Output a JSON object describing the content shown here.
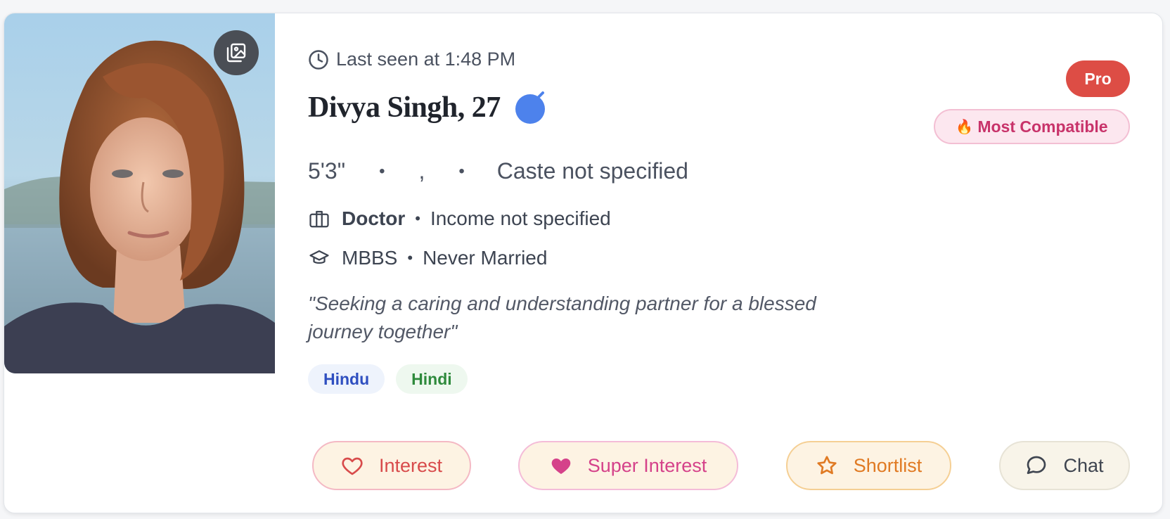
{
  "profile": {
    "last_seen": "Last seen at 1:48 PM",
    "name": "Divya Singh, 27",
    "height": "5'3\"",
    "sep1": "•",
    "location": ",",
    "sep2": "•",
    "caste": "Caste not specified",
    "profession": "Doctor",
    "income": "Income not specified",
    "education": "MBBS",
    "marital_status": "Never Married",
    "bullet": "•",
    "tagline": "\"Seeking a caring and understanding partner for a blessed journey together\"",
    "tags": [
      {
        "label": "Hindu"
      },
      {
        "label": "Hindi"
      }
    ]
  },
  "badges": {
    "pro": "Pro",
    "compat_emoji": "🔥",
    "compat": "Most Compatible"
  },
  "actions": {
    "interest": "Interest",
    "super_interest": "Super Interest",
    "shortlist": "Shortlist",
    "chat": "Chat"
  },
  "icons": {
    "gallery": "gallery-icon",
    "clock": "clock-icon",
    "verified": "verified-icon",
    "briefcase": "briefcase-icon",
    "education": "graduation-cap-icon",
    "heart": "heart-outline-icon",
    "heart_filled": "heart-filled-icon",
    "star": "star-outline-icon",
    "chat": "chat-bubble-icon"
  },
  "colors": {
    "pro": "#dd4d45",
    "compat_text": "#c8336a",
    "verified": "#4d82ec",
    "interest": "#d84b4b",
    "super_interest": "#d5428a",
    "shortlist": "#e07a23"
  }
}
